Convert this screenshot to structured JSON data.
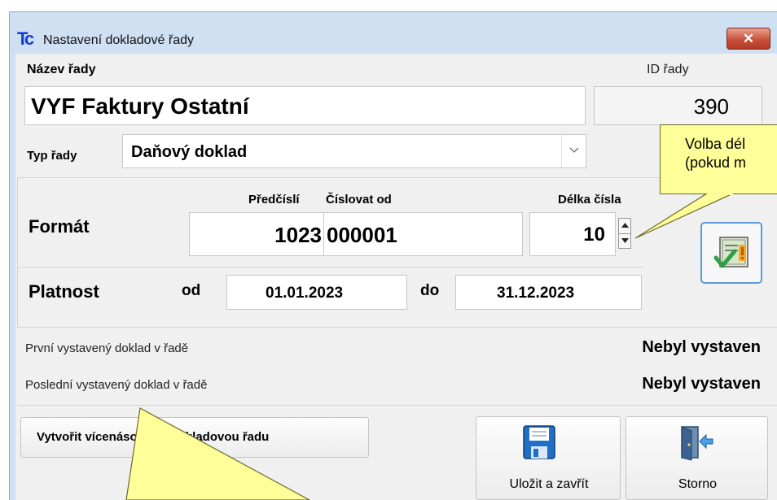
{
  "window": {
    "title": "Nastavení dokladové řady",
    "close_symbol": "✕"
  },
  "series": {
    "name_label": "Název řady",
    "name_value": "VYF Faktury Ostatní",
    "id_label": "ID řady",
    "id_value": "390",
    "type_label": "Typ řady",
    "type_value": "Daňový doklad"
  },
  "format": {
    "label": "Formát",
    "prefix_label": "Předčíslí",
    "number_from_label": "Číslovat od",
    "length_label": "Délka čísla",
    "prefix_value": "1023",
    "number_from_value": "000001",
    "length_value": "10"
  },
  "validity": {
    "label": "Platnost",
    "from_label": "od",
    "from_value": "01.01.2023",
    "to_label": "do",
    "to_value": "31.12.2023"
  },
  "issued": {
    "first_label": "První vystavený doklad v řadě",
    "first_value": "Nebyl vystaven",
    "last_label": "Poslední vystavený doklad v řadě",
    "last_value": "Nebyl vystaven"
  },
  "buttons": {
    "multi_series": "Vytvořit vícenásobnou dokladovou řadu",
    "save_close": "Uložit a zavřít",
    "cancel": "Storno"
  },
  "callout": {
    "line1": "Volba dél",
    "line2": "(pokud m"
  },
  "colors": {
    "callout_fill": "#ffff99",
    "window_frame": "#cfe0f2",
    "close_button": "#c9503a"
  },
  "icons": {
    "app": "tc-app-icon",
    "close": "close-icon",
    "dropdown": "chevron-down-icon",
    "spinner_up": "spinner-up-icon",
    "spinner_down": "spinner-down-icon",
    "check": "document-check-icon",
    "save": "floppy-disk-icon",
    "cancel": "door-exit-icon"
  }
}
